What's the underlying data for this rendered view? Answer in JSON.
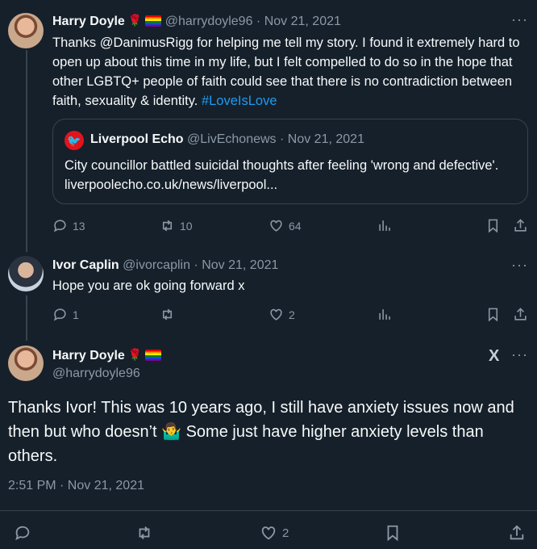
{
  "tweet1": {
    "name": "Harry Doyle",
    "handle": "@harrydoyle96",
    "separator": "·",
    "date": "Nov 21, 2021",
    "text_before_tag": "Thanks @DanimusRigg for helping me tell my story. I found it extremely hard to open up about this time in my life, but I felt compelled to do so in the hope that other LGBTQ+ people of faith could see that there is no contradiction between faith, sexuality & identity. ",
    "hashtag": "#LoveIsLove",
    "quote": {
      "name": "Liverpool Echo",
      "handle": "@LivEchonews",
      "date": "Nov 21, 2021",
      "text": "City councillor battled suicidal thoughts after feeling 'wrong and defective'. liverpoolecho.co.uk/news/liverpool..."
    },
    "replies": "13",
    "retweets": "10",
    "likes": "64"
  },
  "tweet2": {
    "name": "Ivor Caplin",
    "handle": "@ivorcaplin",
    "separator": "·",
    "date": "Nov 21, 2021",
    "text": "Hope you are ok going forward x",
    "replies": "1",
    "likes": "2"
  },
  "main": {
    "name": "Harry Doyle",
    "handle": "@harrydoyle96",
    "text": "Thanks Ivor! This was 10 years ago, I still have anxiety issues now and then but who doesn’t 🤷‍♂️ Some just have higher anxiety levels than others.",
    "timestamp": "2:51 PM · Nov 21, 2021",
    "likes": "2",
    "grok_label": "X"
  },
  "colors": {
    "background": "#15202b",
    "accent": "#1d9bf0",
    "muted": "#8b98a5",
    "border": "#38444d"
  },
  "icons": [
    "reply-icon",
    "retweet-icon",
    "like-icon",
    "views-icon",
    "bookmark-icon",
    "share-icon",
    "more-icon"
  ]
}
